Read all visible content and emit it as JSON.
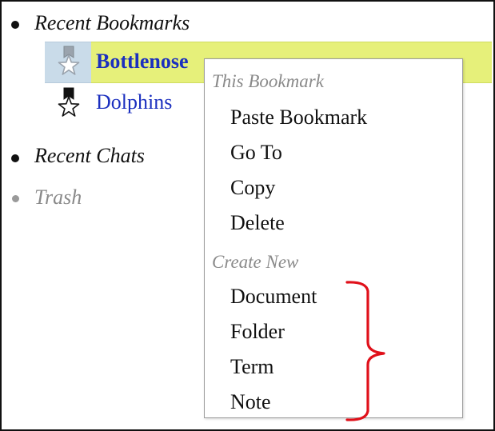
{
  "tree": {
    "sections": [
      {
        "label": "Recent Bookmarks",
        "state": "expanded"
      },
      {
        "label": "Recent Chats",
        "state": "collapsed"
      },
      {
        "label": "Trash",
        "state": "disabled"
      }
    ],
    "bookmarks": [
      {
        "label": "Bottlenose",
        "icon": "bookmark-star-icon",
        "selected": true
      },
      {
        "label": "Dolphins",
        "icon": "bookmark-star-icon",
        "selected": false
      }
    ]
  },
  "context_menu": {
    "groups": [
      {
        "header": "This Bookmark",
        "items": [
          "Paste Bookmark",
          "Go To",
          "Copy",
          "Delete"
        ]
      },
      {
        "header": "Create New",
        "items": [
          "Document",
          "Folder",
          "Term",
          "Note"
        ]
      }
    ]
  },
  "colors": {
    "selection_highlight": "#e6f07a",
    "icon_cell": "#c9dbe9",
    "link": "#1b2fbf",
    "annotation": "#e0101a"
  }
}
